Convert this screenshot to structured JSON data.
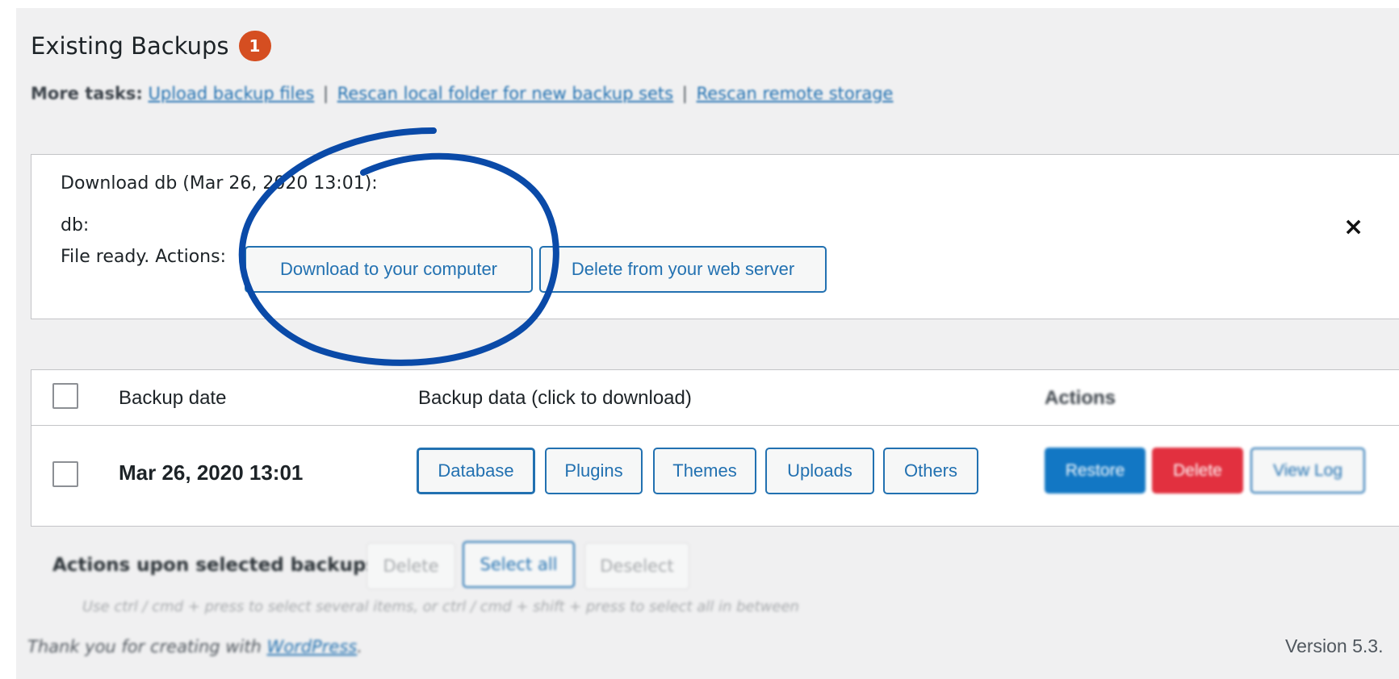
{
  "header": {
    "title": "Existing Backups",
    "badge_count": "1"
  },
  "more_tasks": {
    "label": "More tasks:",
    "links": [
      "Upload backup files",
      "Rescan local folder for new backup sets",
      "Rescan remote storage"
    ],
    "separator": "|"
  },
  "download_panel": {
    "title": "Download db (Mar 26, 2020 13:01):",
    "entity": "db:",
    "status": "File ready. Actions:",
    "download_button": "Download to your computer",
    "delete_button": "Delete from your web server",
    "close_glyph": "×"
  },
  "backups_table": {
    "columns": [
      "Backup date",
      "Backup data (click to download)",
      "Actions"
    ],
    "rows": [
      {
        "date": "Mar 26, 2020 13:01",
        "data_buttons": [
          "Database",
          "Plugins",
          "Themes",
          "Uploads",
          "Others"
        ],
        "actions": [
          "Restore",
          "Delete",
          "View Log"
        ]
      }
    ]
  },
  "bulk_actions": {
    "label": "Actions upon selected backups",
    "buttons": [
      "Delete",
      "Select all",
      "Deselect"
    ],
    "hint": "Use ctrl / cmd + press to select several items, or ctrl / cmd + shift + press to select all in between"
  },
  "footer": {
    "thanks_prefix": "Thank you for creating with",
    "thanks_link": "WordPress",
    "thanks_suffix": ".",
    "version": "Version 5.3."
  },
  "colors": {
    "accent": "#2271b1",
    "badge": "#d54e21",
    "restore": "#1277c4",
    "delete": "#e2303f",
    "annotation_circle": "#0a4aa8",
    "background": "#f0f0f1"
  }
}
